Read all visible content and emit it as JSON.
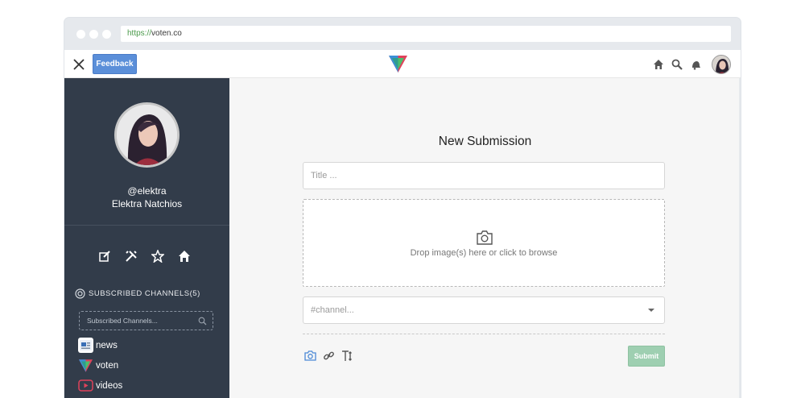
{
  "browser": {
    "url_scheme": "https://",
    "url_host": "voten.co"
  },
  "appbar": {
    "feedback_label": "Feedback",
    "icons": [
      "home-icon",
      "search-icon",
      "notification-bell-icon"
    ]
  },
  "sidebar": {
    "handle": "@elektra",
    "full_name": "Elektra Natchios",
    "action_icons": [
      "edit-icon",
      "tools-icon",
      "star-icon",
      "home-icon"
    ],
    "subscribed_heading": "SUBSCRIBED CHANNELS(5)",
    "search_placeholder": "Subscribed Channels...",
    "channels": [
      {
        "name": "news",
        "icon": "news-icon"
      },
      {
        "name": "voten",
        "icon": "voten-logo-icon"
      },
      {
        "name": "videos",
        "icon": "play-icon"
      }
    ]
  },
  "main": {
    "title": "New Submission",
    "title_placeholder": "Title ...",
    "drop_text": "Drop image(s) here or click to browse",
    "channel_placeholder": "#channel...",
    "submit_label": "Submit",
    "tool_icons": [
      "camera-icon",
      "link-icon",
      "text-icon"
    ]
  },
  "colors": {
    "sidebar_bg": "#323c4a",
    "feedback_bg": "#5b8fd9",
    "submit_bg": "#9ecfb1",
    "main_bg": "#f6f6f6"
  }
}
